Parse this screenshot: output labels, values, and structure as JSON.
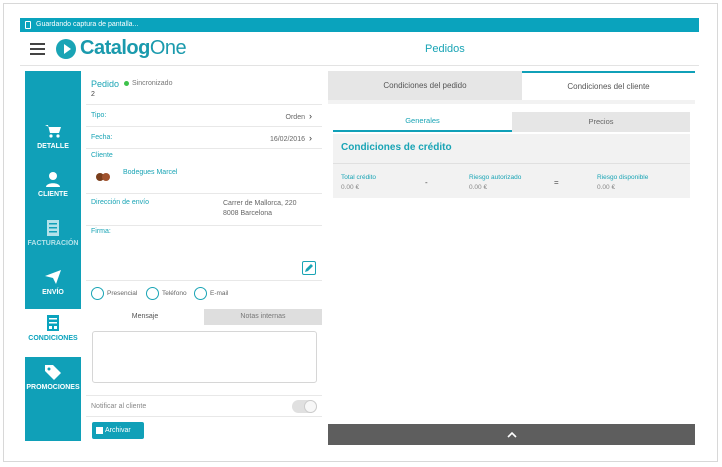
{
  "status_bar": {
    "text": "Guardando captura de pantalla..."
  },
  "header": {
    "logo_part1": "Catalog",
    "logo_part2": "One",
    "title": "Pedidos"
  },
  "sidebar": {
    "items": [
      {
        "label": "DETALLE",
        "icon": "cart-icon"
      },
      {
        "label": "CLIENTE",
        "icon": "person-icon"
      },
      {
        "label": "FACTURACIÓN",
        "icon": "invoice-icon"
      },
      {
        "label": "ENVÍO",
        "icon": "send-icon"
      },
      {
        "label": "CONDICIONES",
        "icon": "conditions-icon"
      },
      {
        "label": "PROMOCIONES",
        "icon": "tag-icon"
      }
    ]
  },
  "order": {
    "label": "Pedido",
    "sync_status": "Sincronizado",
    "number": "2",
    "tipo_label": "Tipo:",
    "tipo_value": "Orden",
    "fecha_label": "Fecha:",
    "fecha_value": "16/02/2016",
    "cliente_label": "Cliente",
    "cliente_name": "Bodegues Marcel",
    "direccion_label": "Dirección de envío",
    "direccion_line1": "Carrer de Mallorca, 220",
    "direccion_line2": "8008 Barcelona",
    "firma_label": "Firma:",
    "contact_options": [
      "Presencial",
      "Teléfono",
      "E-mail"
    ],
    "msg_tabs": [
      "Mensaje",
      "Notas internas"
    ],
    "notify_label": "Notificar al cliente",
    "archive_label": "Archivar"
  },
  "conditions": {
    "top_tabs": [
      "Condiciones del pedido",
      "Condiciones del cliente"
    ],
    "sub_tabs": [
      "Generales",
      "Precios"
    ],
    "section_title": "Condiciones de crédito",
    "total_label": "Total crédito",
    "total_value": "0.00 €",
    "op1": "-",
    "riesgo_aut_label": "Riesgo autorizado",
    "riesgo_aut_value": "0.00 €",
    "op2": "=",
    "riesgo_disp_label": "Riesgo disponible",
    "riesgo_disp_value": "0.00 €"
  },
  "colors": {
    "accent": "#10a0b8",
    "bottombar": "#5e5e5e"
  }
}
